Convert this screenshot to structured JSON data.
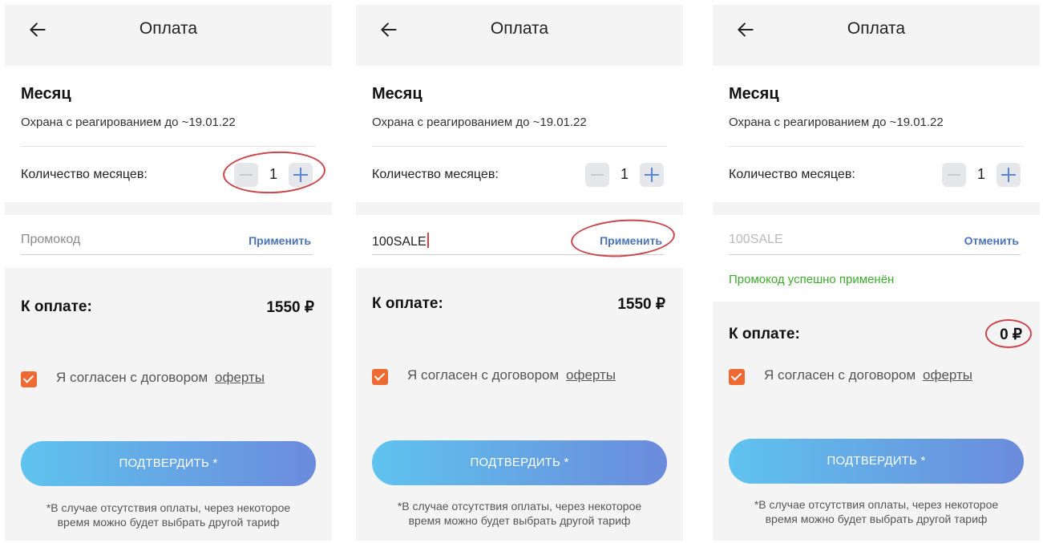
{
  "screens": [
    {
      "title": "Оплата",
      "plan_name": "Месяц",
      "plan_desc": "Охрана с реагированием до ~19.01.22",
      "qty_label": "Количество месяцев:",
      "qty_value": "1",
      "promo_value": "",
      "promo_placeholder": "Промокод",
      "promo_action": "Применить",
      "total_label": "К оплате:",
      "total_value": "1550 ₽",
      "agree_text": "Я согласен с договором",
      "agree_link": "оферты",
      "confirm_label": "ПОДТВЕРДИТЬ *",
      "footnote_line1": "*В случае отсутствия оплаты, через некоторое",
      "footnote_line2": "время можно будет выбрать другой тариф"
    },
    {
      "title": "Оплата",
      "plan_name": "Месяц",
      "plan_desc": "Охрана с реагированием до ~19.01.22",
      "qty_label": "Количество месяцев:",
      "qty_value": "1",
      "promo_value": "100SALE",
      "promo_action": "Применить",
      "total_label": "К оплате:",
      "total_value": "1550 ₽",
      "agree_text": "Я согласен с договором",
      "agree_link": "оферты",
      "confirm_label": "ПОДТВЕРДИТЬ *",
      "footnote_line1": "*В случае отсутствия оплаты, через некоторое",
      "footnote_line2": "время можно будет выбрать другой тариф"
    },
    {
      "title": "Оплата",
      "plan_name": "Месяц",
      "plan_desc": "Охрана с реагированием до ~19.01.22",
      "qty_label": "Количество месяцев:",
      "qty_value": "1",
      "promo_value": "100SALE",
      "promo_action": "Отменить",
      "promo_success": "Промокод успешно применён",
      "total_label": "К оплате:",
      "total_value": "0 ₽",
      "agree_text": "Я согласен с договором",
      "agree_link": "оферты",
      "confirm_label": "ПОДТВЕРДИТЬ *",
      "footnote_line1": "*В случае отсутствия оплаты, через некоторое",
      "footnote_line2": "время можно будет выбрать другой тариф"
    }
  ],
  "checkbox_checked": true,
  "colors": {
    "accent_orange": "#ee6a32",
    "link_blue": "#4b73b8",
    "success_green": "#3cab2c",
    "annotation_red": "#c9454a",
    "button_gradient_start": "#5fc3ef",
    "button_gradient_end": "#6b8bdc"
  }
}
